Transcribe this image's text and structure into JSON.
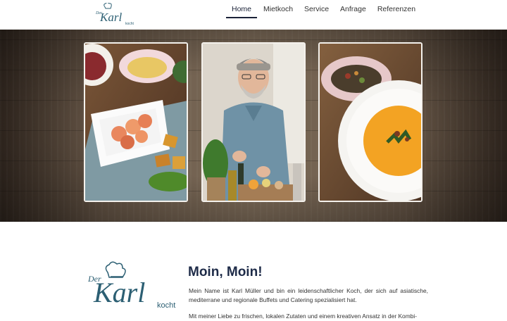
{
  "brand": {
    "logo_small": {
      "der": "Der",
      "karl": "Karl",
      "kocht": "kocht"
    },
    "logo_large": {
      "der": "Der",
      "karl": "Karl",
      "kocht": "kocht"
    },
    "colors": {
      "navy": "#1e2b48",
      "teal": "#2c5f73"
    }
  },
  "nav": {
    "items": [
      {
        "label": "Home",
        "active": true
      },
      {
        "label": "Mietkoch",
        "active": false
      },
      {
        "label": "Service",
        "active": false
      },
      {
        "label": "Anfrage",
        "active": false
      },
      {
        "label": "Referenzen",
        "active": false
      }
    ]
  },
  "hero": {
    "photos": [
      "shrimp-and-dips-photo",
      "chef-portrait-photo",
      "pumpkin-soup-photo"
    ]
  },
  "intro": {
    "title": "Moin, Moin!",
    "paragraph_1": "Mein Name ist Karl Müller und bin ein leidenschaftlicher Koch, der sich auf asiatische, mediterrane und regionale Buffets und Catering spezialisiert hat.",
    "paragraph_2": "Mit meiner Liebe zu frischen, lokalen Zutaten und einem kreativen Ansatz in der Kombi-"
  }
}
